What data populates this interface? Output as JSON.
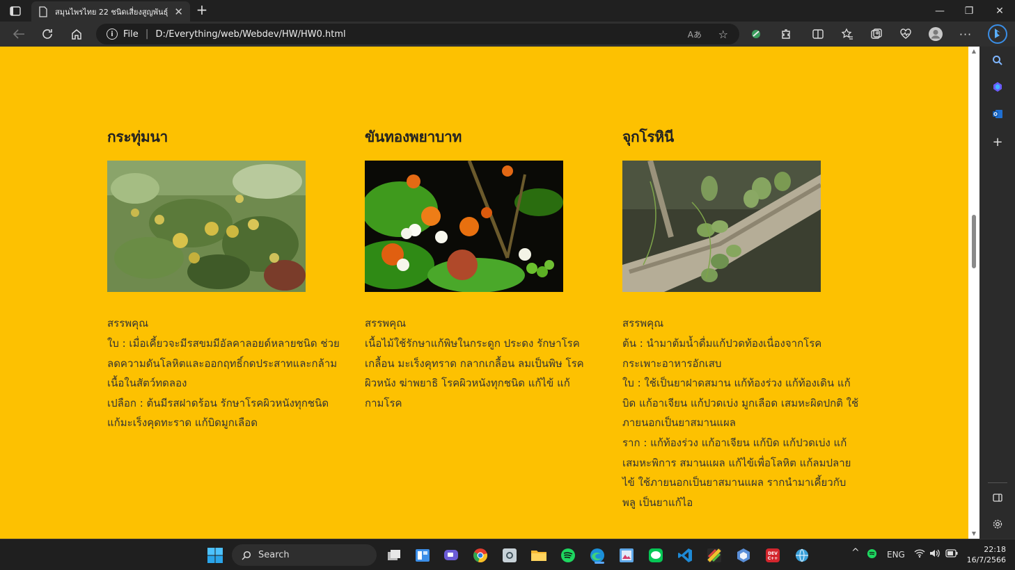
{
  "browser": {
    "tab_title": "สมุนไพรไทย 22 ชนิดเสี่ยงสูญพันธุ์",
    "address_scheme": "File",
    "address_url": "D:/Everything/web/Webdev/HW/HW0.html",
    "read_aloud_glyph": "Aあ"
  },
  "herbs": [
    {
      "name": "กระทุ่มนา",
      "properties_heading": "สรรพคุณ",
      "lines": [
        "ใบ : เมื่อเคี้ยวจะมีรสขมมีอัลคาลอยด์หลายชนิด ช่วยลดความดันโลหิตและออกฤทธิ์กดประสาทและกล้ามเนื้อในสัตว์ทดลอง",
        "เปลือก : ต้นมีรสฝาดร้อน รักษาโรคผิวหนังทุกชนิด แก้มะเร็งคุดทะราด แก้บิดมูกเลือด"
      ]
    },
    {
      "name": "ขันทองพยาบาท",
      "properties_heading": "สรรพคุณ",
      "lines": [
        "เนื้อไม้ใช้รักษาแก้พิษในกระดูก ประดง รักษาโรคเกลื้อน มะเร็งคุทราด กลากเกลื้อน ลมเป็นพิษ โรคผิวหนัง ฆ่าพยาธิ โรคผิวหนังทุกชนิด แก้ไข้ แก้กามโรค"
      ]
    },
    {
      "name": "จุกโรหินี",
      "properties_heading": "สรรพคุณ",
      "lines": [
        "ต้น : นำมาต้มน้ำดื่มแก้ปวดท้องเนื่องจากโรคกระเพาะอาหารอักเสบ",
        "ใบ : ใช้เป็นยาฝาดสมาน แก้ท้องร่วง แก้ท้องเดิน แก้บิด แก้อาเจียน แก้ปวดเบ่ง มูกเลือด เสมหะผิดปกติ ใช้ภายนอกเป็นยาสมานแผล",
        "ราก : แก้ท้องร่วง แก้อาเจียน แก้บิด แก้ปวดเบ่ง แก้เสมหะพิการ สมานแผล แก้ไข้เพื่อโลหิต แก้ลมปลายไข้ ใช้ภายนอกเป็นยาสมานแผล รากนำมาเคี้ยวกับพลู เป็นยาแก้ไอ"
      ]
    }
  ],
  "taskbar": {
    "search_placeholder": "Search",
    "language": "ENG",
    "time": "22:18",
    "date": "16/7/2566"
  },
  "colors": {
    "page_background": "#FDC101",
    "text": "#333333"
  }
}
